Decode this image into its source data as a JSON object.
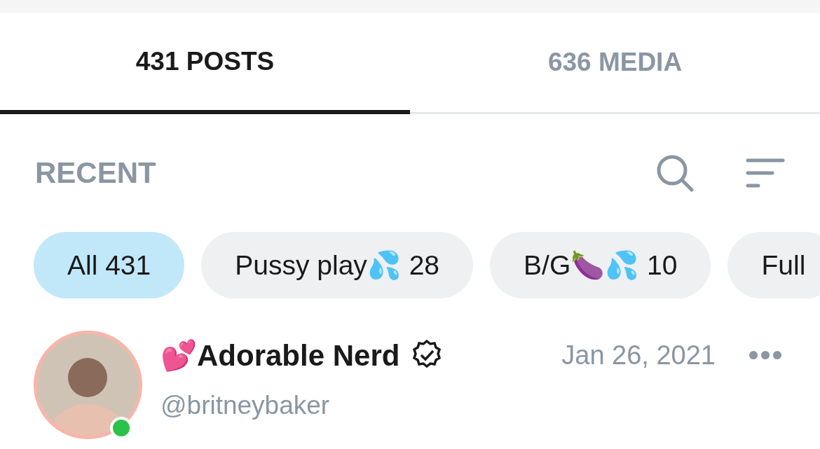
{
  "tabs": [
    {
      "label": "431 POSTS",
      "selected": true
    },
    {
      "label": "636 MEDIA",
      "selected": false
    }
  ],
  "section": {
    "title": "RECENT"
  },
  "filters": [
    {
      "label": "All 431",
      "selected": true
    },
    {
      "label": "Pussy play💦 28",
      "selected": false
    },
    {
      "label": "B/G🍆💦 10",
      "selected": false
    },
    {
      "label": "Full",
      "selected": false
    }
  ],
  "post": {
    "name": "💕Adorable Nerd",
    "verified": true,
    "handle": "@britneybaker",
    "online": true,
    "date": "Jan 26, 2021"
  }
}
